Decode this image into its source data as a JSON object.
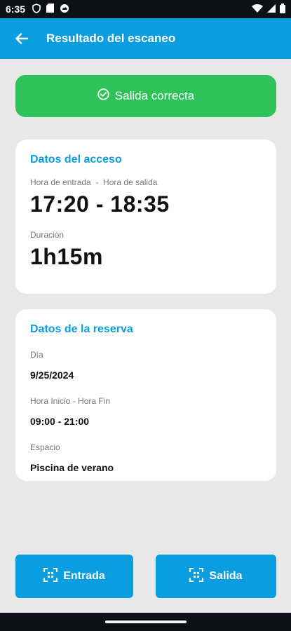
{
  "status_bar": {
    "time": "6:35",
    "icons": [
      "shield-icon",
      "sim-card-icon",
      "cloud-icon",
      "wifi-icon",
      "signal-icon",
      "battery-icon"
    ]
  },
  "app_bar": {
    "title": "Resultado del escaneo",
    "back_icon": "arrow-left-icon"
  },
  "banner": {
    "text": "Salida correcta",
    "icon": "check-circle-icon",
    "color": "#2fc25b"
  },
  "access": {
    "title": "Datos del acceso",
    "times_label": "Hora de entrada  -  Hora de salida",
    "times_value": "17:20 - 18:35",
    "duration_label": "Duración",
    "duration_value": "1h15m"
  },
  "reservation": {
    "title": "Datos de la reserva",
    "day_label": "Día",
    "day_value": "9/25/2024",
    "hours_label": "Hora Inicio - Hora Fin",
    "hours_value": "09:00 - 21:00",
    "space_label": "Espacio",
    "space_value": "Piscina de verano"
  },
  "buttons": {
    "entrada": "Entrada",
    "salida": "Salida",
    "icon": "qr-scan-icon"
  },
  "colors": {
    "primary": "#0a9de0",
    "success": "#2fc25b"
  }
}
